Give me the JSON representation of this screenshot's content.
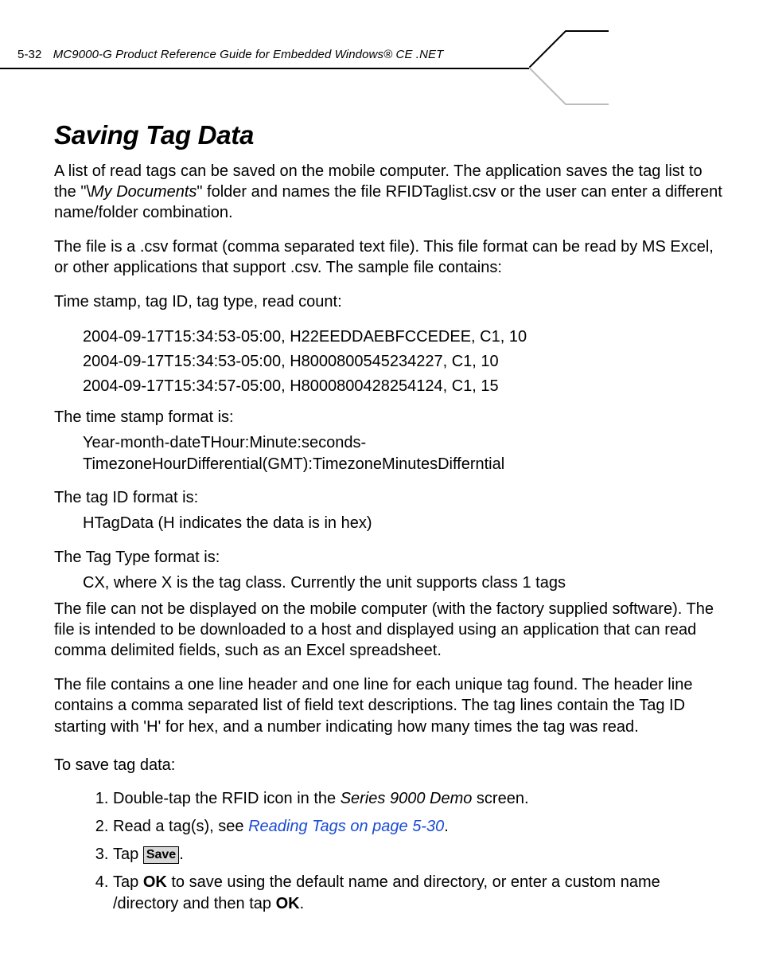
{
  "header": {
    "page_num": "5-32",
    "title": "MC9000-G Product Reference Guide for Embedded Windows® CE .NET"
  },
  "section_title": "Saving Tag Data",
  "para1_a": "A list of read tags can be saved on the mobile computer. The application saves the tag list to the \"\\",
  "para1_my_docs": "My Documents",
  "para1_b": "\" folder and names the file RFIDTaglist.csv or the user can enter a different name/folder combination.",
  "para2": "The file is a .csv format (comma separated text file). This file format can be read by MS Excel, or other applications that support .csv. The sample file contains:",
  "para3": "Time stamp, tag ID, tag type, read count:",
  "samples": [
    "2004-09-17T15:34:53-05:00, H22EEDDAEBFCCEDEE, C1, 10",
    "2004-09-17T15:34:53-05:00, H8000800545234227, C1, 10",
    "2004-09-17T15:34:57-05:00, H8000800428254124, C1, 15"
  ],
  "ts_label": "The time stamp format is:",
  "ts_format": "Year-month-dateTHour:Minute:seconds-TimezoneHourDifferential(GMT):TimezoneMinutesDifferntial",
  "tagid_label": "The tag ID format is:",
  "tagid_format": "HTagData (H indicates the data is in hex)",
  "tagtype_label": "The Tag Type format is:",
  "tagtype_format": "CX, where X is the tag class. Currently the unit supports class 1 tags",
  "para4": "The file can not be displayed on the mobile computer (with the factory supplied software). The file is intended to be downloaded to a host and displayed using an application that can read comma delimited fields, such as an Excel spreadsheet.",
  "para5": "The file contains a one line header and one line for each unique tag found. The header line contains a comma separated list of field text descriptions. The tag lines contain the Tag ID starting with 'H' for hex, and a number indicating how many times the tag was read.",
  "to_save": "To save tag data:",
  "steps": {
    "s1_a": "Double-tap the RFID icon in the ",
    "s1_i": "Series 9000 Demo",
    "s1_b": " screen.",
    "s2_a": "Read a tag(s), see ",
    "s2_link": "Reading Tags on page 5-30",
    "s2_b": ".",
    "s3_a": "Tap ",
    "s3_save": "Save",
    "s3_b": ".",
    "s4_a": "Tap ",
    "s4_ok1": "OK",
    "s4_b": " to save using the default name and directory, or enter a custom name /directory and then tap ",
    "s4_ok2": "OK",
    "s4_c": "."
  }
}
